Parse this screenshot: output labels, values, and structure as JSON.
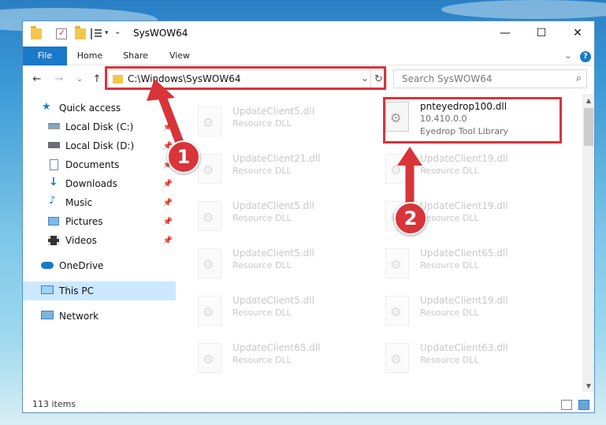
{
  "window": {
    "title": "SysWOW64",
    "minimize": "—",
    "maximize": "☐",
    "close": "✕"
  },
  "ribbon": {
    "tabs": [
      "File",
      "Home",
      "Share",
      "View"
    ],
    "expand": "⌄",
    "help": "?"
  },
  "nav": {
    "back": "←",
    "forward": "→",
    "recent": "⌄",
    "up": "↑",
    "address": "C:\\Windows\\SysWOW64",
    "refresh": "↻",
    "dropdown": "⌄",
    "search_placeholder": "Search SysWOW64"
  },
  "sidebar": {
    "items": [
      {
        "label": "Quick access",
        "icon": "star-icon",
        "pinned": false
      },
      {
        "label": "Local Disk (C:)",
        "icon": "drive-icon",
        "pinned": true
      },
      {
        "label": "Local Disk (D:)",
        "icon": "drive-icon",
        "pinned": true
      },
      {
        "label": "Documents",
        "icon": "document-icon",
        "pinned": true
      },
      {
        "label": "Downloads",
        "icon": "download-icon",
        "pinned": true
      },
      {
        "label": "Music",
        "icon": "music-icon",
        "pinned": true
      },
      {
        "label": "Pictures",
        "icon": "pictures-icon",
        "pinned": true
      },
      {
        "label": "Videos",
        "icon": "video-icon",
        "pinned": true
      },
      {
        "label": "OneDrive",
        "icon": "cloud-icon",
        "pinned": false
      },
      {
        "label": "This PC",
        "icon": "computer-icon",
        "pinned": false
      },
      {
        "label": "Network",
        "icon": "network-icon",
        "pinned": false
      }
    ],
    "pin_glyph": "📌"
  },
  "files": {
    "left": [
      {
        "name": "UpdateClient5.dll",
        "type": "Resource DLL"
      },
      {
        "name": "UpdateClient21.dll",
        "type": "Resource DLL"
      },
      {
        "name": "UpdateClient5.dll",
        "type": "Resource DLL"
      },
      {
        "name": "UpdateClient5.dll",
        "type": "Resource DLL"
      },
      {
        "name": "UpdateClient5.dll",
        "type": "Resource DLL"
      },
      {
        "name": "UpdateClient65.dll",
        "type": "Resource DLL"
      }
    ],
    "right": [
      {
        "name": "pnteyedrop100.dll",
        "version": "10.410.0.0",
        "type": "Eyedrop Tool Library"
      },
      {
        "name": "UpdateClient19.dll",
        "type": "Resource DLL"
      },
      {
        "name": "UpdateClient19.dll",
        "type": "Resource DLL"
      },
      {
        "name": "UpdateClient65.dll",
        "type": "Resource DLL"
      },
      {
        "name": "UpdateClient19.dll",
        "type": "Resource DLL"
      },
      {
        "name": "UpdateClient63.dll",
        "type": "Resource DLL"
      }
    ]
  },
  "status": {
    "count": "113 items"
  },
  "markers": [
    "1",
    "2"
  ],
  "colors": {
    "accent": "#1979ca",
    "highlight": "#d8343a",
    "selected": "#cce8ff"
  }
}
